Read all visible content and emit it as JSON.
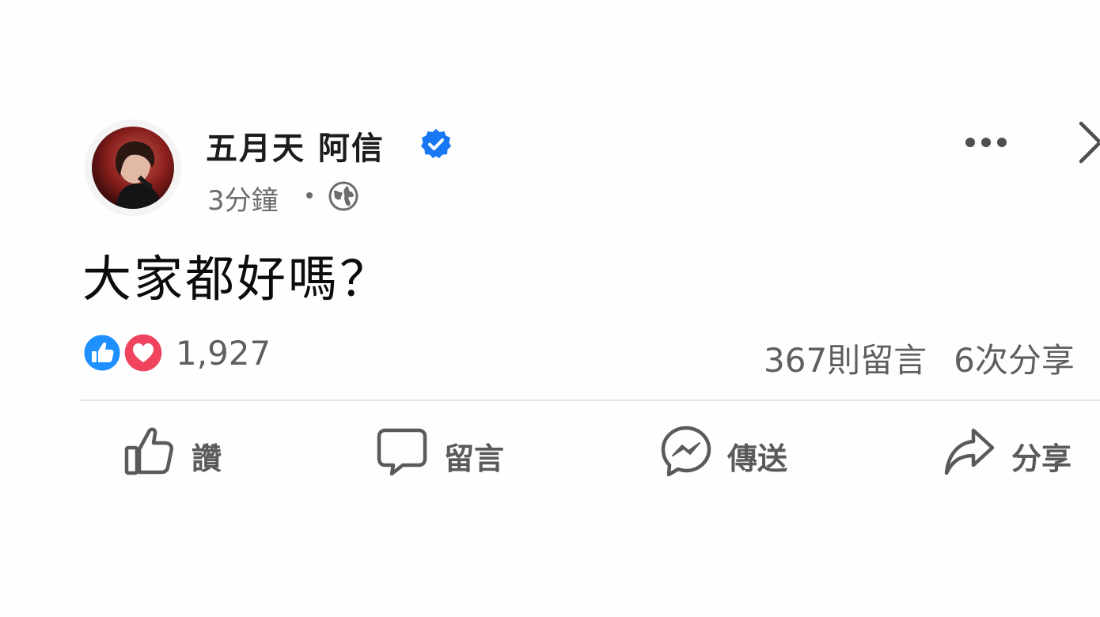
{
  "post": {
    "author_name": "五月天 阿信",
    "time_text": "3分鐘",
    "body_text": "大家都好嗎？"
  },
  "stats": {
    "reaction_count": "1,927",
    "comments_text": "367則留言",
    "shares_text": "6次分享"
  },
  "actions": {
    "like_label": "讚",
    "comment_label": "留言",
    "send_label": "傳送",
    "share_label": "分享"
  },
  "icons": {
    "verified": "verified-badge-icon",
    "audience": "globe-icon",
    "menu": "more-dots-icon",
    "close": "close-icon",
    "like_reaction": "thumbs-up-reaction-icon",
    "love_reaction": "heart-reaction-icon",
    "like_action": "thumbs-up-icon",
    "comment_action": "speech-bubble-icon",
    "send_action": "messenger-icon",
    "share_action": "share-arrow-icon"
  },
  "colors": {
    "verified_blue": "#1877f2",
    "like_blue": "#1e90ff",
    "love_red": "#f0435e",
    "text_dark": "#1c1c1c",
    "text_muted": "#5f5f5f",
    "divider": "#e4e4e4"
  }
}
